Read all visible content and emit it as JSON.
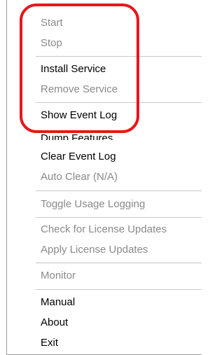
{
  "menu": {
    "groups": [
      {
        "items": [
          {
            "label": "Start",
            "enabled": false
          },
          {
            "label": "Stop",
            "enabled": false
          }
        ]
      },
      {
        "items": [
          {
            "label": "Install Service",
            "enabled": true
          },
          {
            "label": "Remove Service",
            "enabled": false
          }
        ]
      },
      {
        "items": [
          {
            "label": "Show Event Log",
            "enabled": true
          },
          {
            "label": "Dump Features",
            "enabled": true
          },
          {
            "label": "Clear Event Log",
            "enabled": true
          },
          {
            "label": "Auto Clear (N/A)",
            "enabled": false
          }
        ]
      },
      {
        "items": [
          {
            "label": "Toggle Usage Logging",
            "enabled": false
          }
        ]
      },
      {
        "items": [
          {
            "label": "Check for License Updates",
            "enabled": false
          },
          {
            "label": "Apply License Updates",
            "enabled": false
          }
        ]
      },
      {
        "items": [
          {
            "label": "Monitor",
            "enabled": false
          }
        ]
      },
      {
        "items": [
          {
            "label": "Manual",
            "enabled": true
          },
          {
            "label": "About",
            "enabled": true
          },
          {
            "label": "Exit",
            "enabled": true
          }
        ]
      }
    ]
  },
  "colors": {
    "enabled_text": "#000000",
    "disabled_text": "#8a8a8a",
    "separator": "#c8c8c8",
    "highlight_border": "#e8161b"
  }
}
